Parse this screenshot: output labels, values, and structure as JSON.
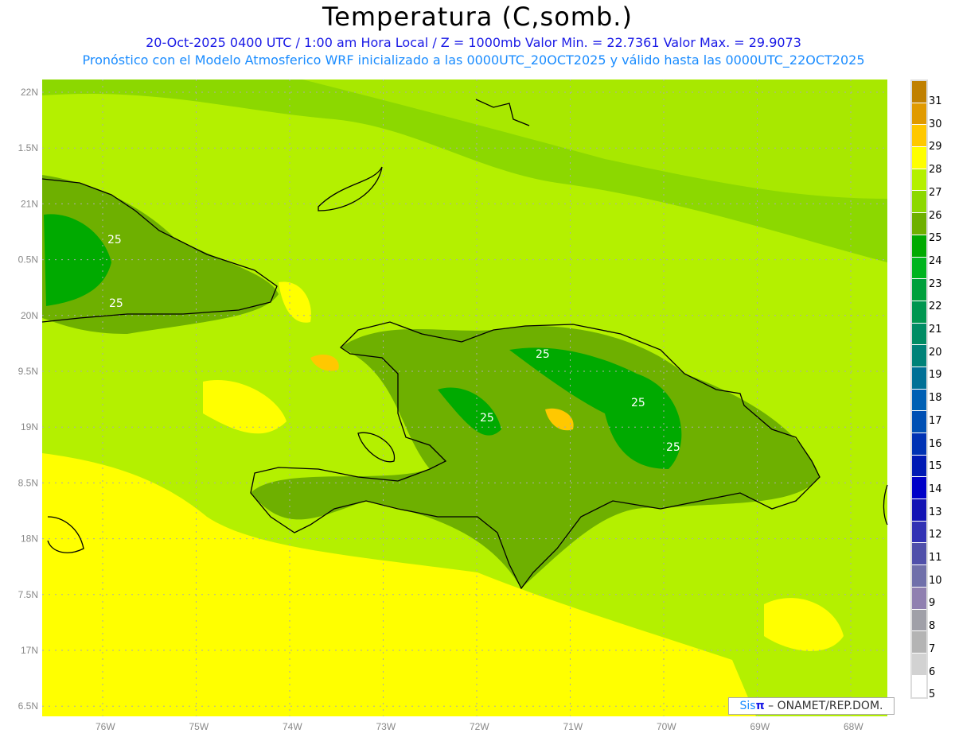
{
  "title": "Temperatura (C,somb.)",
  "subtitle1": "20-Oct-2025  0400 UTC / 1:00 am Hora Local / Z = 1000mb   Valor Min. = 22.7361  Valor Max. = 29.9073",
  "subtitle2": "Pronóstico con el Modelo Atmosferico WRF inicializado a las 0000UTC_20OCT2025 y válido hasta las  0000UTC_22OCT2025",
  "lon_labels": [
    "76W",
    "75W",
    "74W",
    "73W",
    "72W",
    "71W",
    "70W",
    "69W",
    "68W"
  ],
  "lat_labels": [
    "22N",
    "1.5N",
    "21N",
    "0.5N",
    "20N",
    "9.5N",
    "19N",
    "8.5N",
    "18N",
    "7.5N",
    "17N",
    "6.5N"
  ],
  "contour_labels": [
    "25",
    "25",
    "25",
    "25",
    "25",
    "25"
  ],
  "colorbar": {
    "labels": [
      "31",
      "30",
      "29",
      "28",
      "27",
      "26",
      "25",
      "24",
      "23",
      "22",
      "21",
      "20",
      "19",
      "18",
      "17",
      "16",
      "15",
      "14",
      "13",
      "12",
      "11",
      "10",
      "9",
      "8",
      "7",
      "6",
      "5"
    ],
    "colors": [
      "#c08000",
      "#e09a00",
      "#ffc800",
      "#ffff00",
      "#b4f000",
      "#8cd800",
      "#6eb000",
      "#00aa00",
      "#00b41e",
      "#00a03c",
      "#009650",
      "#008c64",
      "#008278",
      "#007096",
      "#0060b4",
      "#0050b4",
      "#0032b4",
      "#0019b4",
      "#0000c8",
      "#1414b4",
      "#3232b4",
      "#5050aa",
      "#7070aa",
      "#9080b0",
      "#a0a0a8",
      "#b4b4b4",
      "#d2d2d2",
      "#ffffff"
    ]
  },
  "logo": {
    "sis": "Sis",
    "pi": "π",
    "text": "– ONAMET/REP.DOM."
  }
}
